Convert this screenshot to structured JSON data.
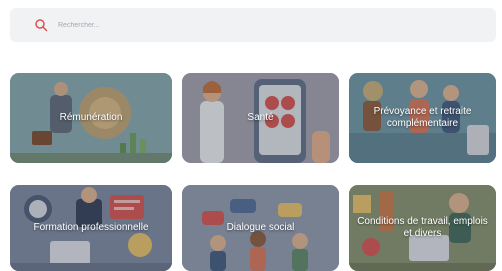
{
  "search": {
    "placeholder": "Rechercher...",
    "icon": "search-icon",
    "icon_color": "#d9534f"
  },
  "categories": [
    {
      "label": "Rémunération",
      "color": "#7aa0a8"
    },
    {
      "label": "Santé",
      "color": "#8f8fa0"
    },
    {
      "label": "Prévoyance et retraite complémentaire",
      "color": "#5f8d9e"
    },
    {
      "label": "Formation professionnelle",
      "color": "#6f7e90"
    },
    {
      "label": "Dialogue social",
      "color": "#8594a6"
    },
    {
      "label": "Conditions de travail, emplois et divers",
      "color": "#7d8a6c"
    }
  ]
}
